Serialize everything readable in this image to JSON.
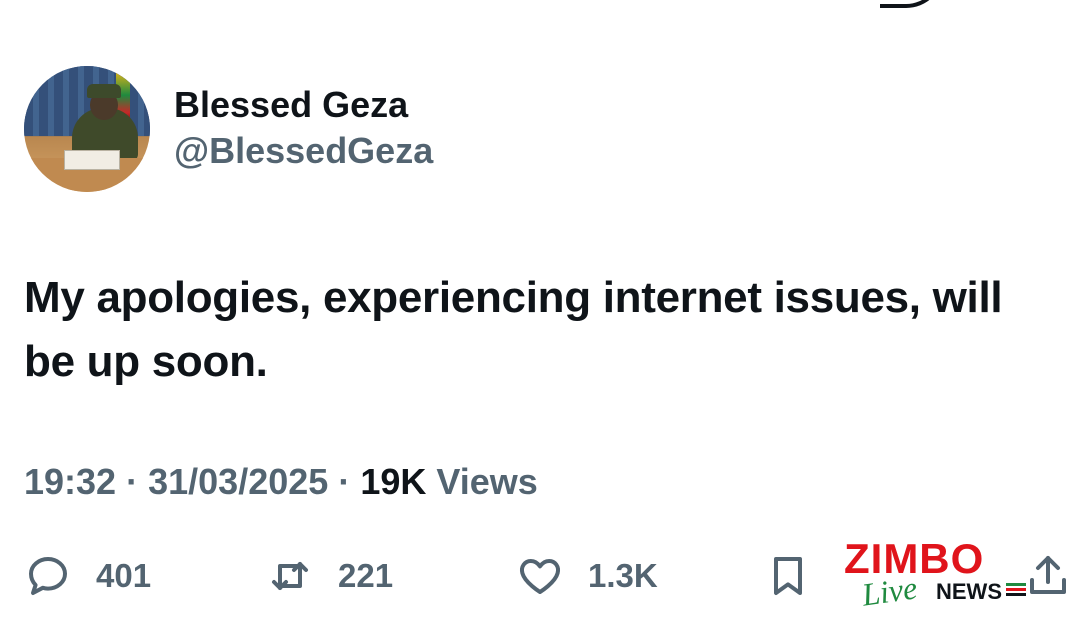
{
  "author": {
    "display_name": "Blessed Geza",
    "handle": "@BlessedGeza",
    "avatar_icon": "profile-photo"
  },
  "tweet": {
    "text": "My apologies, experiencing internet issues, will be up soon."
  },
  "meta": {
    "time": "19:32",
    "separator": "·",
    "date": "31/03/2025",
    "views_count": "19K",
    "views_label": "Views"
  },
  "actions": {
    "replies": "401",
    "retweets": "221",
    "likes": "1.3K"
  },
  "watermark": {
    "brand": "ZIMBO",
    "script": "Live",
    "news": "NEWS"
  },
  "colors": {
    "text_primary": "#0f1419",
    "text_secondary": "#536471",
    "watermark_red": "#e0141b",
    "watermark_green": "#1f8a3f"
  }
}
